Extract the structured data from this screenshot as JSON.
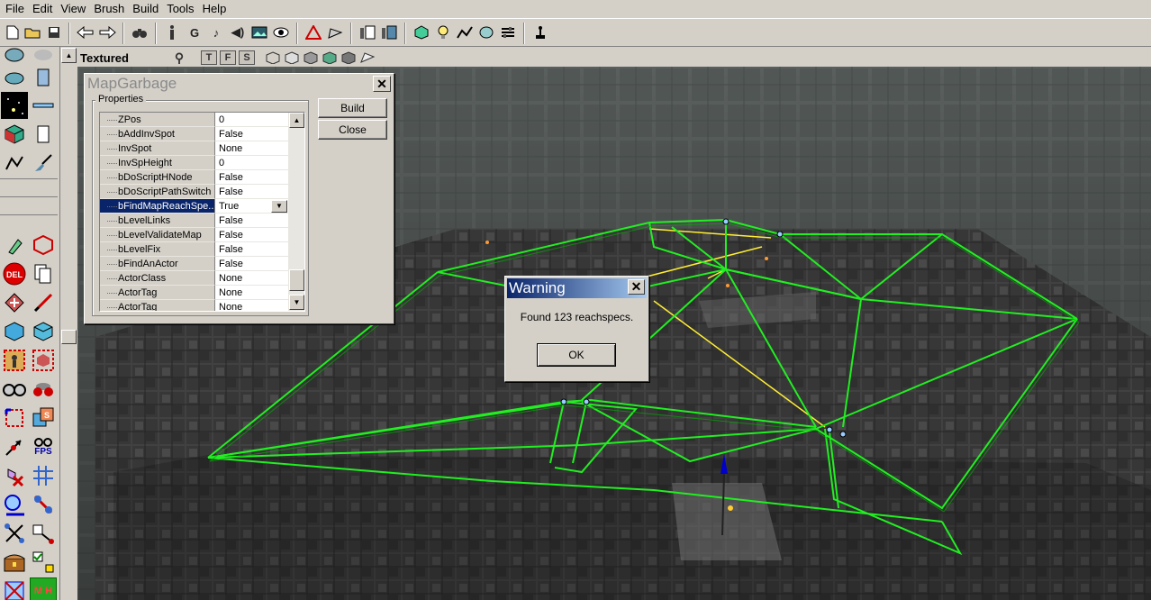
{
  "menu": [
    "File",
    "Edit",
    "View",
    "Brush",
    "Build",
    "Tools",
    "Help"
  ],
  "toolbar": {
    "icons": [
      "new-map-icon",
      "open-icon",
      "save-icon",
      "undo-icon",
      "redo-icon",
      "search-actors-icon",
      "actor-properties-icon",
      "group-browser-icon",
      "music-browser-icon",
      "sound-browser-icon",
      "texture-browser-icon",
      "mesh-viewer-icon",
      "build-geometry-icon",
      "build-lighting-icon",
      "build-paths-icon",
      "build-all-icon",
      "prefab-icon",
      "light-icon",
      "paths-icon",
      "sound-icon",
      "options-icon",
      "joystick-icon"
    ]
  },
  "viewport": {
    "title": "Textured",
    "mode_letters": [
      "T",
      "F",
      "S"
    ]
  },
  "palette": {
    "fps_label": "FPS",
    "del_label": "DEL",
    "mh_label": "M H"
  },
  "mapgarbage": {
    "title": "MapGarbage",
    "group_label": "Properties",
    "build_label": "Build",
    "close_label": "Close",
    "properties": [
      {
        "name": "ZPos",
        "value": "0"
      },
      {
        "name": "bAddInvSpot",
        "value": "False"
      },
      {
        "name": "InvSpot",
        "value": "None"
      },
      {
        "name": "InvSpHeight",
        "value": "0"
      },
      {
        "name": "bDoScriptHNode",
        "value": "False"
      },
      {
        "name": "bDoScriptPathSwitch",
        "value": "False"
      },
      {
        "name": "bFindMapReachSpe...",
        "value": "True"
      },
      {
        "name": "bLevelLinks",
        "value": "False"
      },
      {
        "name": "bLevelValidateMap",
        "value": "False"
      },
      {
        "name": "bLevelFix",
        "value": "False"
      },
      {
        "name": "bFindAnActor",
        "value": "False"
      },
      {
        "name": "ActorClass",
        "value": "None"
      },
      {
        "name": "ActorTag",
        "value": "None"
      },
      {
        "name": "ActorTag",
        "value": "None"
      }
    ],
    "selected_row": 6
  },
  "warning": {
    "title": "Warning",
    "message": "Found 123 reachspecs.",
    "ok_label": "OK"
  },
  "colors": {
    "selection": "#0a246a",
    "path_lines": "#22ee22",
    "reachspec_lines": "#ffee33",
    "dialog_face": "#d4d0c8"
  }
}
